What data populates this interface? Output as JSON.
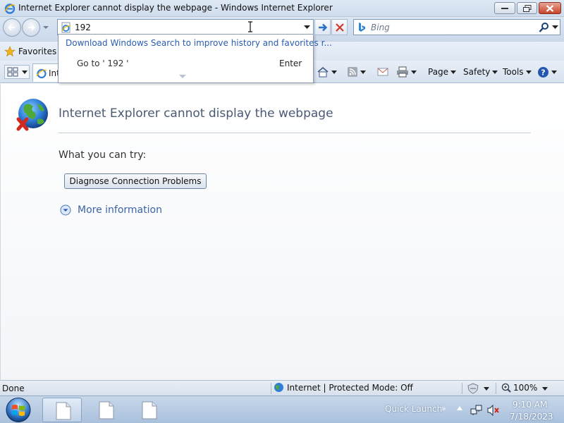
{
  "window": {
    "title": "Internet Explorer cannot display the webpage - Windows Internet Explorer",
    "controls": [
      "minimize-icon",
      "maximize-icon",
      "close-icon"
    ]
  },
  "navbar": {
    "address_value": "192",
    "search_placeholder": "Bing",
    "icons": [
      "back-arrow-icon",
      "forward-arrow-icon",
      "go-arrow-icon",
      "stop-x-icon",
      "search-magnifier-icon",
      "bing-logo-icon"
    ]
  },
  "autocomplete": {
    "suggestion": "Download Windows Search to improve history and favorites r...",
    "goto_text": "Go to ' 192 '",
    "enter_label": "Enter"
  },
  "favorites_bar": {
    "favorites_label": "Favorites"
  },
  "command_bar": {
    "tab_label": "Int",
    "page_label": "Page",
    "safety_label": "Safety",
    "tools_label": "Tools",
    "icons": [
      "quick-tabs-icon",
      "home-icon",
      "rss-feed-icon",
      "read-mail-icon",
      "print-icon",
      "help-icon"
    ]
  },
  "content": {
    "error_title": "Internet Explorer cannot display the webpage",
    "try_label": "What you can try:",
    "diagnose_button": "Diagnose Connection Problems",
    "more_info": "More information"
  },
  "statusbar": {
    "status": "Done",
    "zone": "Internet | Protected Mode: Off",
    "zoom": "100%"
  },
  "taskbar": {
    "quick_launch": "Quick Launch",
    "ql_chevron": "»",
    "time": "9:10 AM",
    "date": "7/18/2023"
  },
  "colors": {
    "link_blue": "#3b63a5",
    "error_title": "#4a5a74",
    "close_red": "#c7432a",
    "taskbar": "#a9c0dc"
  }
}
